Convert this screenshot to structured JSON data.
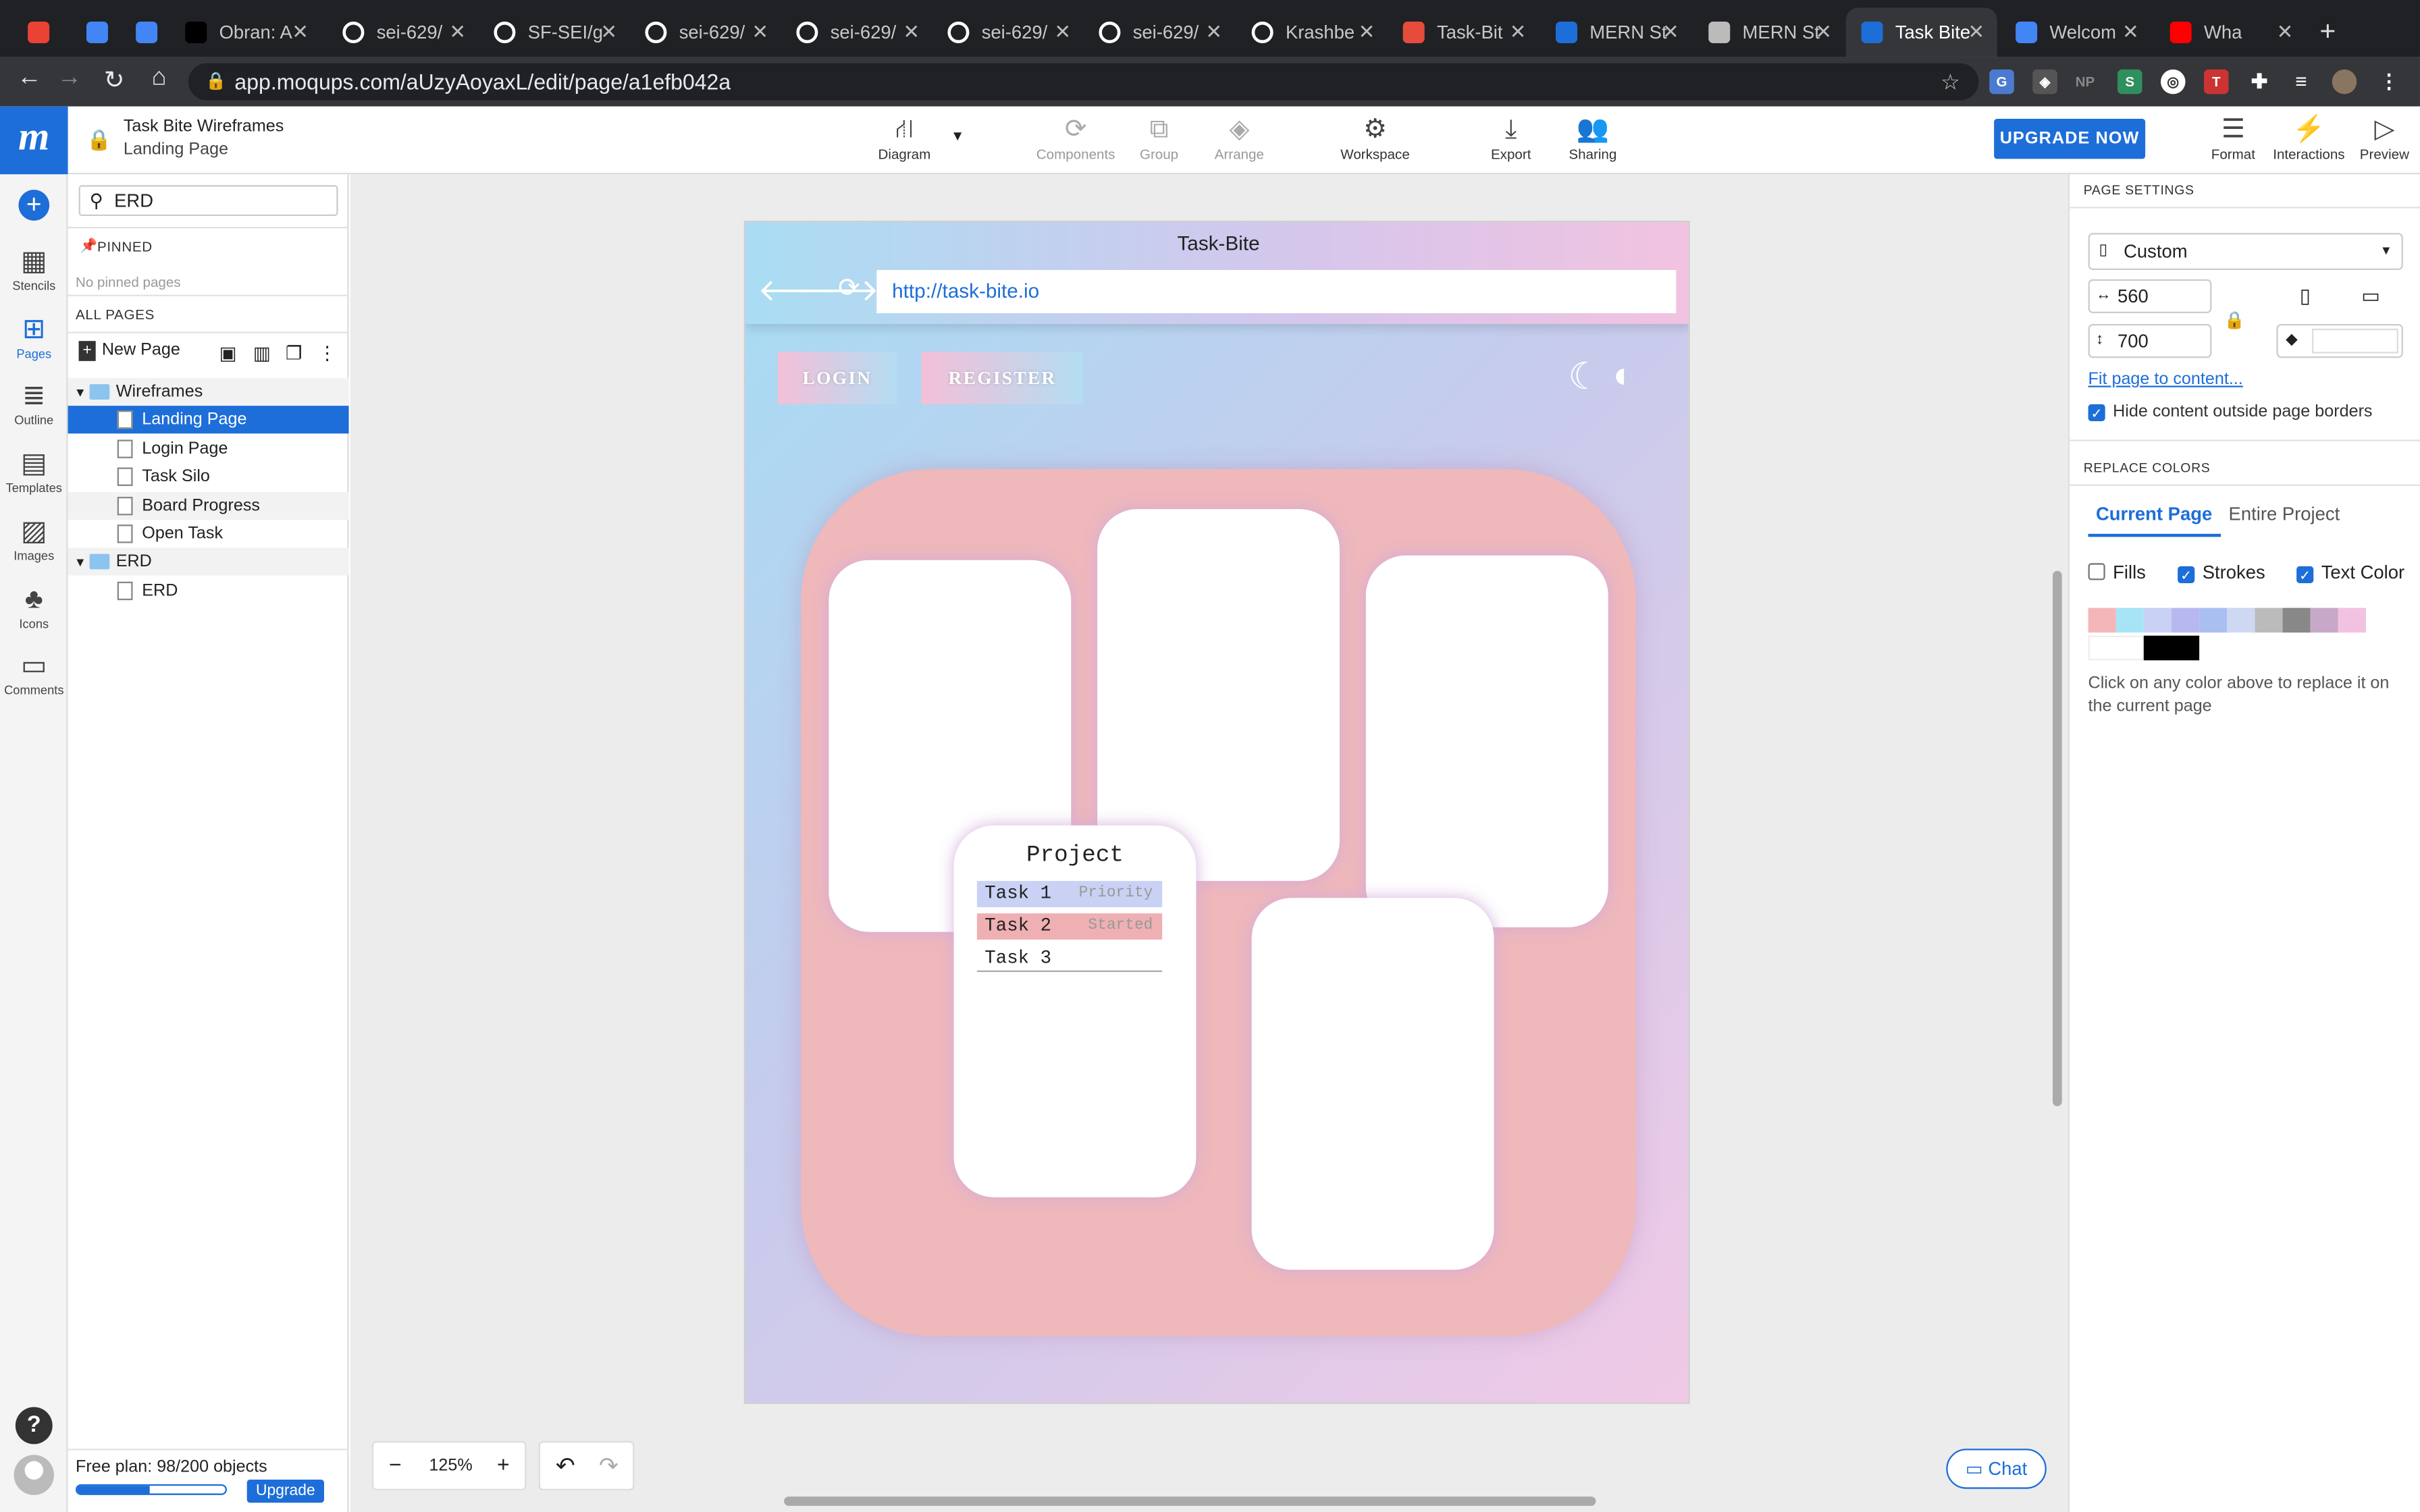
{
  "browser": {
    "tabs": [
      {
        "label": "",
        "icon": "gmail-icon",
        "color": "#ea4335"
      },
      {
        "label": "",
        "icon": "calendar-icon",
        "color": "#4285f4"
      },
      {
        "label": "",
        "icon": "docs-icon",
        "color": "#4285f4"
      },
      {
        "label": "Obran: A",
        "icon": "medium-icon",
        "color": "#000000"
      },
      {
        "label": "sei-629/",
        "icon": "github-icon",
        "color": "#ffffff"
      },
      {
        "label": "SF-SEI/g",
        "icon": "github-icon",
        "color": "#ffffff"
      },
      {
        "label": "sei-629/",
        "icon": "github-icon",
        "color": "#ffffff"
      },
      {
        "label": "sei-629/",
        "icon": "github-icon",
        "color": "#ffffff"
      },
      {
        "label": "sei-629/",
        "icon": "github-icon",
        "color": "#ffffff"
      },
      {
        "label": "sei-629/",
        "icon": "github-icon",
        "color": "#ffffff"
      },
      {
        "label": "Krashbe",
        "icon": "github-icon",
        "color": "#ffffff"
      },
      {
        "label": "Task-Bit",
        "icon": "trello-icon",
        "color": "#e64c3c"
      },
      {
        "label": "MERN St",
        "icon": "trello-icon",
        "color": "#1d6ed8"
      },
      {
        "label": "MERN St",
        "icon": "page-icon",
        "color": "#bbbbbb"
      },
      {
        "label": "Task Bite",
        "icon": "moqups-icon",
        "color": "#1d6ed8",
        "active": true
      },
      {
        "label": "Welcom",
        "icon": "docs-icon",
        "color": "#4285f4"
      },
      {
        "label": "Wha",
        "icon": "youtube-icon",
        "color": "#ff0000"
      }
    ],
    "url": "app.moqups.com/aUzyAoyaxL/edit/page/a1efb042a"
  },
  "app": {
    "project_title": "Task Bite Wireframes",
    "page_title": "Landing Page",
    "toolbar": {
      "diagram": "Diagram",
      "components": "Components",
      "group": "Group",
      "arrange": "Arrange",
      "workspace": "Workspace",
      "export": "Export",
      "sharing": "Sharing",
      "upgrade": "UPGRADE NOW",
      "format": "Format",
      "interactions": "Interactions",
      "preview": "Preview"
    },
    "rail": [
      "Stencils",
      "Pages",
      "Outline",
      "Templates",
      "Images",
      "Icons",
      "Comments"
    ]
  },
  "pages_panel": {
    "search_value": "ERD",
    "pinned_label": "PINNED",
    "no_pinned": "No pinned pages",
    "all_pages_label": "ALL PAGES",
    "new_page": "New Page",
    "tree": [
      {
        "label": "Wireframes",
        "type": "folder"
      },
      {
        "label": "Landing Page",
        "type": "page",
        "selected": true
      },
      {
        "label": "Login Page",
        "type": "page"
      },
      {
        "label": "Task Silo",
        "type": "page"
      },
      {
        "label": "Board Progress",
        "type": "page"
      },
      {
        "label": "Open Task",
        "type": "page"
      },
      {
        "label": "ERD",
        "type": "folder"
      },
      {
        "label": "ERD",
        "type": "page"
      }
    ],
    "plan_text": "Free plan: 98/200 objects",
    "plan_progress": 0.49,
    "upgrade": "Upgrade"
  },
  "mockup": {
    "title": "Task-Bite",
    "url": "http://task-bite.io",
    "login": "LOGIN",
    "register": "REGISTER",
    "card": {
      "title": "Project",
      "tasks": [
        {
          "name": "Task 1",
          "status": "Priority"
        },
        {
          "name": "Task 2",
          "status": "Started"
        },
        {
          "name": "Task 3",
          "status": ""
        }
      ]
    }
  },
  "canvas": {
    "zoom": "125%"
  },
  "chat": "Chat",
  "settings": {
    "page_settings": "PAGE SETTINGS",
    "preset": "Custom",
    "width": "560",
    "height": "700",
    "fit_link": "Fit page to content...",
    "hide_outside": "Hide content outside page borders",
    "replace_colors": "REPLACE COLORS",
    "tab_current": "Current Page",
    "tab_entire": "Entire Project",
    "fills": "Fills",
    "strokes": "Strokes",
    "text_color": "Text Color",
    "hint": "Click on any color above to replace it on the current page",
    "swatches": [
      "#f4b6b8",
      "#a6e4f6",
      "#c9d2f4",
      "#b8b8f0",
      "#a9bff2",
      "#cfd8f2",
      "#bbbbbb",
      "#888888",
      "#c8a8c8",
      "#f2c3e0",
      "#ffffff",
      "#000000"
    ]
  }
}
